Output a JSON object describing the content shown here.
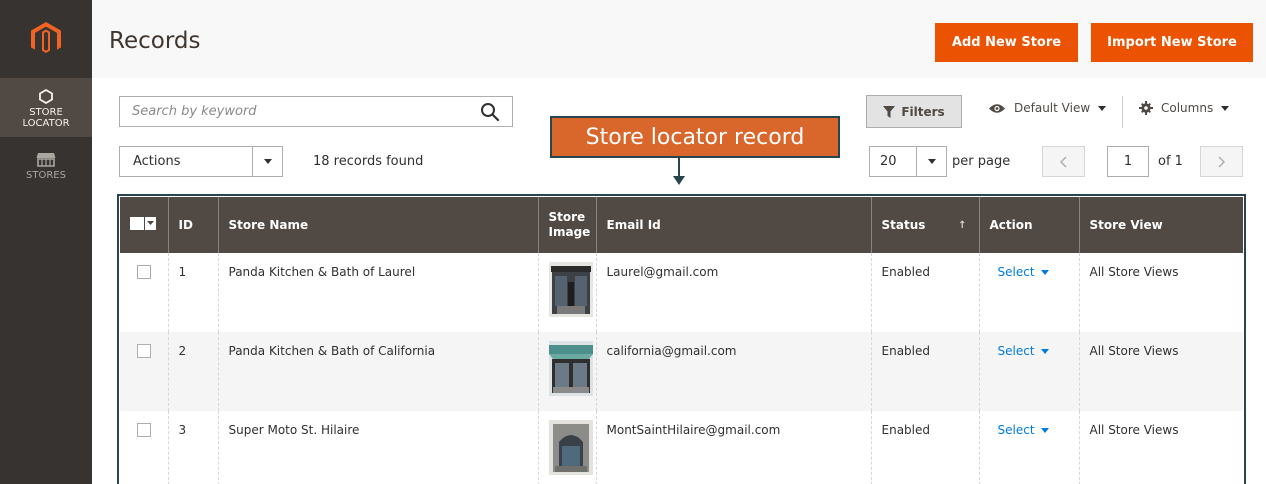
{
  "sidebar": {
    "items": [
      {
        "label_line1": "STORE",
        "label_line2": "LOCATOR",
        "icon": "hexagon-icon"
      },
      {
        "label_line1": "STORES",
        "label_line2": "",
        "icon": "store-icon"
      }
    ]
  },
  "header": {
    "title": "Records",
    "add_button": "Add New Store",
    "import_button": "Import New Store"
  },
  "toolbar": {
    "search_placeholder": "Search by keyword",
    "filters_label": "Filters",
    "view_label": "Default View",
    "columns_label": "Columns",
    "actions_label": "Actions",
    "records_found": "18 records found",
    "per_page_value": "20",
    "per_page_label": "per page",
    "current_page": "1",
    "of_label": "of 1"
  },
  "annotation": {
    "text": "Store locator record"
  },
  "grid": {
    "columns": [
      "ID",
      "Store Name",
      "Store Image",
      "Email Id",
      "Status",
      "Action",
      "Store View"
    ],
    "rows": [
      {
        "id": "1",
        "name": "Panda Kitchen & Bath of Laurel",
        "email": "Laurel@gmail.com",
        "status": "Enabled",
        "action": "Select",
        "view": "All Store Views"
      },
      {
        "id": "2",
        "name": "Panda Kitchen & Bath of California",
        "email": "california@gmail.com",
        "status": "Enabled",
        "action": "Select",
        "view": "All Store Views"
      },
      {
        "id": "3",
        "name": "Super Moto St. Hilaire",
        "email": "MontSaintHilaire@gmail.com",
        "status": "Enabled",
        "action": "Select",
        "view": "All Store Views"
      }
    ]
  },
  "colors": {
    "accent": "#eb5202",
    "sidebar_bg": "#373330",
    "grid_header_bg": "#514943",
    "link": "#007bdb",
    "annotation_bg": "#d9662a",
    "annotation_border": "#26454f"
  }
}
